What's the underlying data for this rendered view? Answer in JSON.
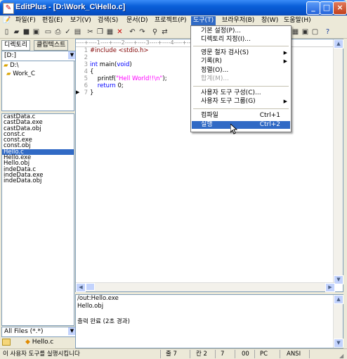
{
  "window": {
    "title": "EditPlus - [D:\\Work_C\\Hello.c]",
    "minimize": "_",
    "maximize": "□",
    "close": "×"
  },
  "menu": {
    "items": [
      "파일(F)",
      "편집(E)",
      "보기(V)",
      "검색(S)",
      "문서(D)",
      "프로젝트(P)",
      "도구(T)",
      "브라우저(B)",
      "창(W)",
      "도움말(H)"
    ]
  },
  "left_panel": {
    "tabs": [
      "디렉토리",
      "클립텍스트"
    ],
    "drive": "[D:]",
    "tree": [
      "D:\\",
      "Work_C"
    ],
    "files": [
      "castData.c",
      "castData.exe",
      "castData.obj",
      "const.c",
      "const.exe",
      "const.obj",
      "Hello.c",
      "Hello.exe",
      "Hello.obj",
      "indeData.c",
      "indeData.exe",
      "indeData.obj"
    ],
    "selected_file": "Hello.c",
    "filter": "All Files (*.*)",
    "doc_tab": "Hello.c"
  },
  "editor": {
    "line_numbers": [
      "1",
      "2",
      "3",
      "4",
      "5",
      "6",
      "7"
    ],
    "lines": {
      "l1": "#include <stdio.h>",
      "l3a": "int",
      "l3b": " main(",
      "l3c": "void",
      "l3d": ")",
      "l4": "{",
      "l5a": "    printf(",
      "l5b": "\"Hell World!!\\n\"",
      "l5c": ");",
      "l6a": "    return",
      "l6b": " 0;",
      "l7": "}"
    },
    "ruler": "----+----1----+----2----+----3----+----4----+----5----+----6----+----7----+----8"
  },
  "output": {
    "lines": [
      "/out:Hello.exe",
      "Hello.obj",
      "",
      "출력 완료 (2초 경과)"
    ]
  },
  "dropdown": {
    "items": [
      {
        "label": "기본 설정(P)...",
        "shortcut": ""
      },
      {
        "label": "디렉토리 지정(I)...",
        "shortcut": ""
      },
      {
        "label": "영문 철자 검사(S)",
        "shortcut": "",
        "submenu": "▶"
      },
      {
        "label": "기록(R)",
        "shortcut": "",
        "submenu": "▶"
      },
      {
        "label": "정렬(O)...",
        "shortcut": ""
      },
      {
        "label": "합계(M)...",
        "shortcut": ""
      },
      {
        "label": "사용자 도구 구성(C)...",
        "shortcut": ""
      },
      {
        "label": "사용자 도구 그룹(G)",
        "shortcut": "",
        "submenu": "▶"
      },
      {
        "label": "컴파일",
        "shortcut": "Ctrl+1"
      },
      {
        "label": "실행",
        "shortcut": "Ctrl+2"
      }
    ]
  },
  "status_bar": {
    "message": "이 사용자 도구를 실행시킵니다",
    "line": "줄 7",
    "col": "칸 2",
    "num": "7",
    "code": "00",
    "mode": "PC",
    "encoding": "ANSI"
  },
  "colors": {
    "selection": "#316AC5",
    "keyword": "#0000FF",
    "string": "#FF00FF",
    "title_bar": "#0A5FD8"
  }
}
